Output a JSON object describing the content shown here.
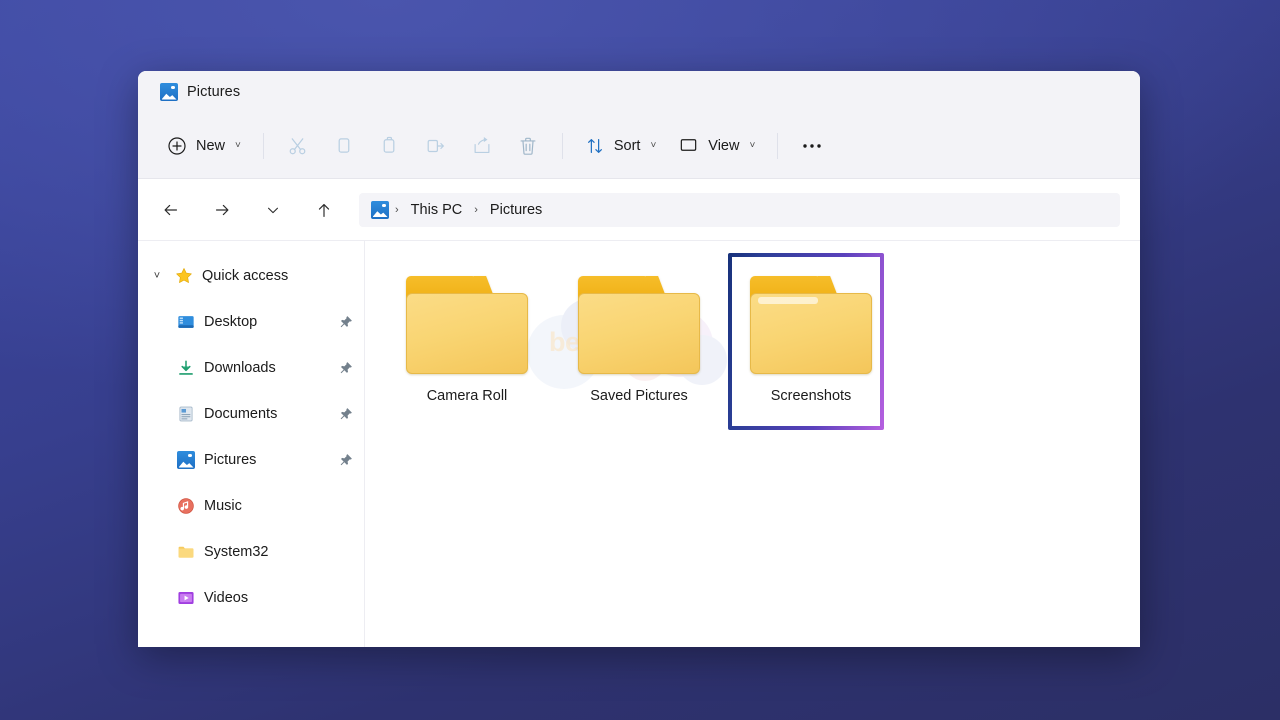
{
  "desktop": {
    "background_top": "#3c47a2",
    "background_bottom": "#2c2f66"
  },
  "window": {
    "title": "Pictures",
    "title_icon": "pictures-icon"
  },
  "toolbar": {
    "new_label": "New",
    "new_icon": "plus-circle-icon",
    "cut_icon": "scissors-icon",
    "copy_icon": "copy-icon",
    "paste_icon": "paste-icon",
    "rename_icon": "rename-icon",
    "share_icon": "share-icon",
    "delete_icon": "trash-icon",
    "sort_label": "Sort",
    "sort_icon": "sort-arrows-icon",
    "view_label": "View",
    "view_icon": "view-monitor-icon",
    "more_icon": "ellipsis-icon",
    "chevron": "˅"
  },
  "navbar": {
    "back_icon": "arrow-left-icon",
    "forward_icon": "arrow-right-icon",
    "recent_icon": "chevron-down-icon",
    "up_icon": "arrow-up-icon",
    "address_icon": "pictures-icon",
    "breadcrumbs": [
      "This PC",
      "Pictures"
    ],
    "separator": "›"
  },
  "sidebar": {
    "header": {
      "label": "Quick access",
      "icon": "star-icon",
      "twisty": "˅",
      "expanded": true
    },
    "items": [
      {
        "label": "Desktop",
        "icon": "desktop-icon",
        "pinned": true
      },
      {
        "label": "Downloads",
        "icon": "download-icon",
        "pinned": true
      },
      {
        "label": "Documents",
        "icon": "documents-icon",
        "pinned": true
      },
      {
        "label": "Pictures",
        "icon": "pictures-icon",
        "pinned": true
      },
      {
        "label": "Music",
        "icon": "music-icon",
        "pinned": false
      },
      {
        "label": "System32",
        "icon": "folder-icon",
        "pinned": false
      },
      {
        "label": "Videos",
        "icon": "videos-icon",
        "pinned": false
      }
    ]
  },
  "content": {
    "items": [
      {
        "label": "Camera Roll",
        "icon": "folder-icon",
        "selected": false
      },
      {
        "label": "Saved Pictures",
        "icon": "folder-icon",
        "selected": false
      },
      {
        "label": "Screenshots",
        "icon": "folder-icon",
        "selected": true
      }
    ],
    "highlight": {
      "target": "Screenshots",
      "gradient_start": "#17317a",
      "gradient_end": "#b660e0"
    },
    "watermark": {
      "text": "bersistem",
      "subtext": "· · · · ·"
    }
  }
}
